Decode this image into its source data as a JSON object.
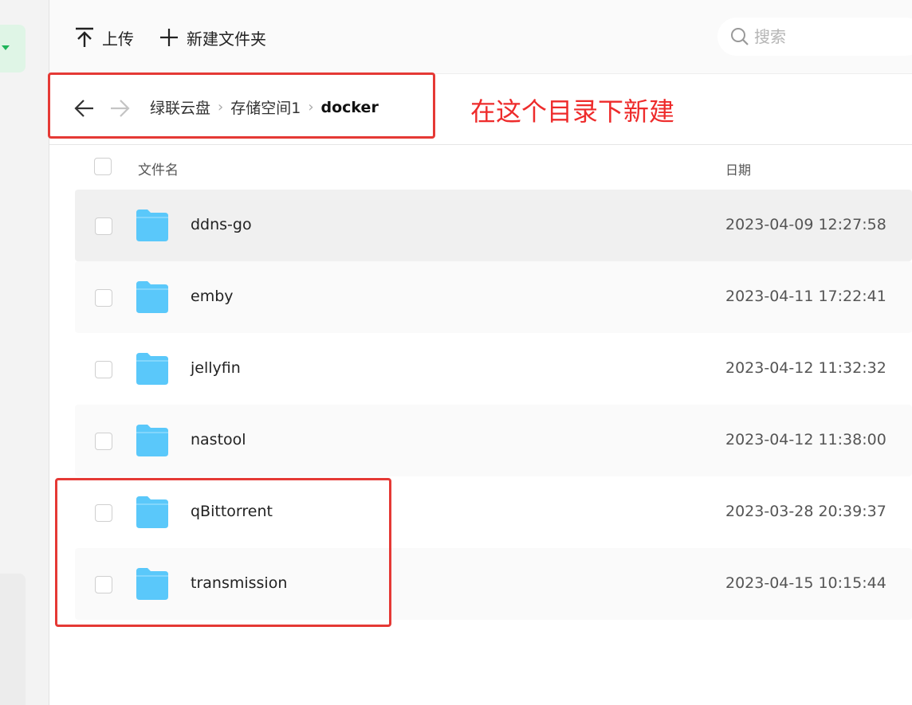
{
  "toolbar": {
    "upload_label": "上传",
    "new_folder_label": "新建文件夹",
    "search_placeholder": "搜索"
  },
  "breadcrumb": {
    "items": [
      "绿联云盘",
      "存储空间1",
      "docker"
    ]
  },
  "annotation": {
    "text": "在这个目录下新建",
    "color": "#e53935"
  },
  "table": {
    "headers": {
      "name": "文件名",
      "date": "日期"
    },
    "rows": [
      {
        "name": "ddns-go",
        "date": "2023-04-09 12:27:58"
      },
      {
        "name": "emby",
        "date": "2023-04-11 17:22:41"
      },
      {
        "name": "jellyfin",
        "date": "2023-04-12 11:32:32"
      },
      {
        "name": "nastool",
        "date": "2023-04-12 11:38:00"
      },
      {
        "name": "qBittorrent",
        "date": "2023-03-28 20:39:37"
      },
      {
        "name": "transmission",
        "date": "2023-04-15 10:15:44"
      }
    ]
  },
  "colors": {
    "folder": "#5ac8fa",
    "accent_green": "#1fb45a"
  },
  "icons": {
    "upload": "upload-icon",
    "new_folder": "plus-icon",
    "search": "search-icon",
    "back": "arrow-left-icon",
    "forward": "arrow-right-icon",
    "folder": "folder-icon"
  }
}
